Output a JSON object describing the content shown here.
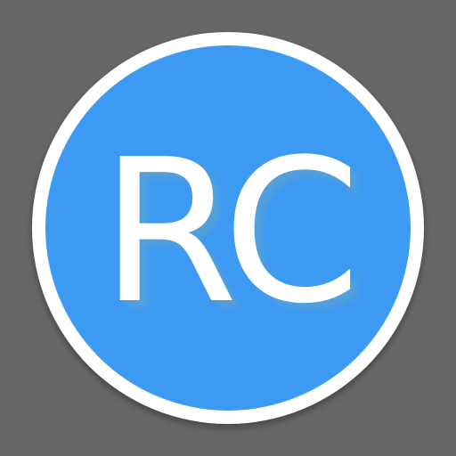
{
  "logo": {
    "text": "RC"
  },
  "colors": {
    "background": "#676767",
    "ring": "#ffffff",
    "circle": "#3d9af2",
    "text": "#ffffff",
    "text_shadow": "#1f5f9a"
  }
}
